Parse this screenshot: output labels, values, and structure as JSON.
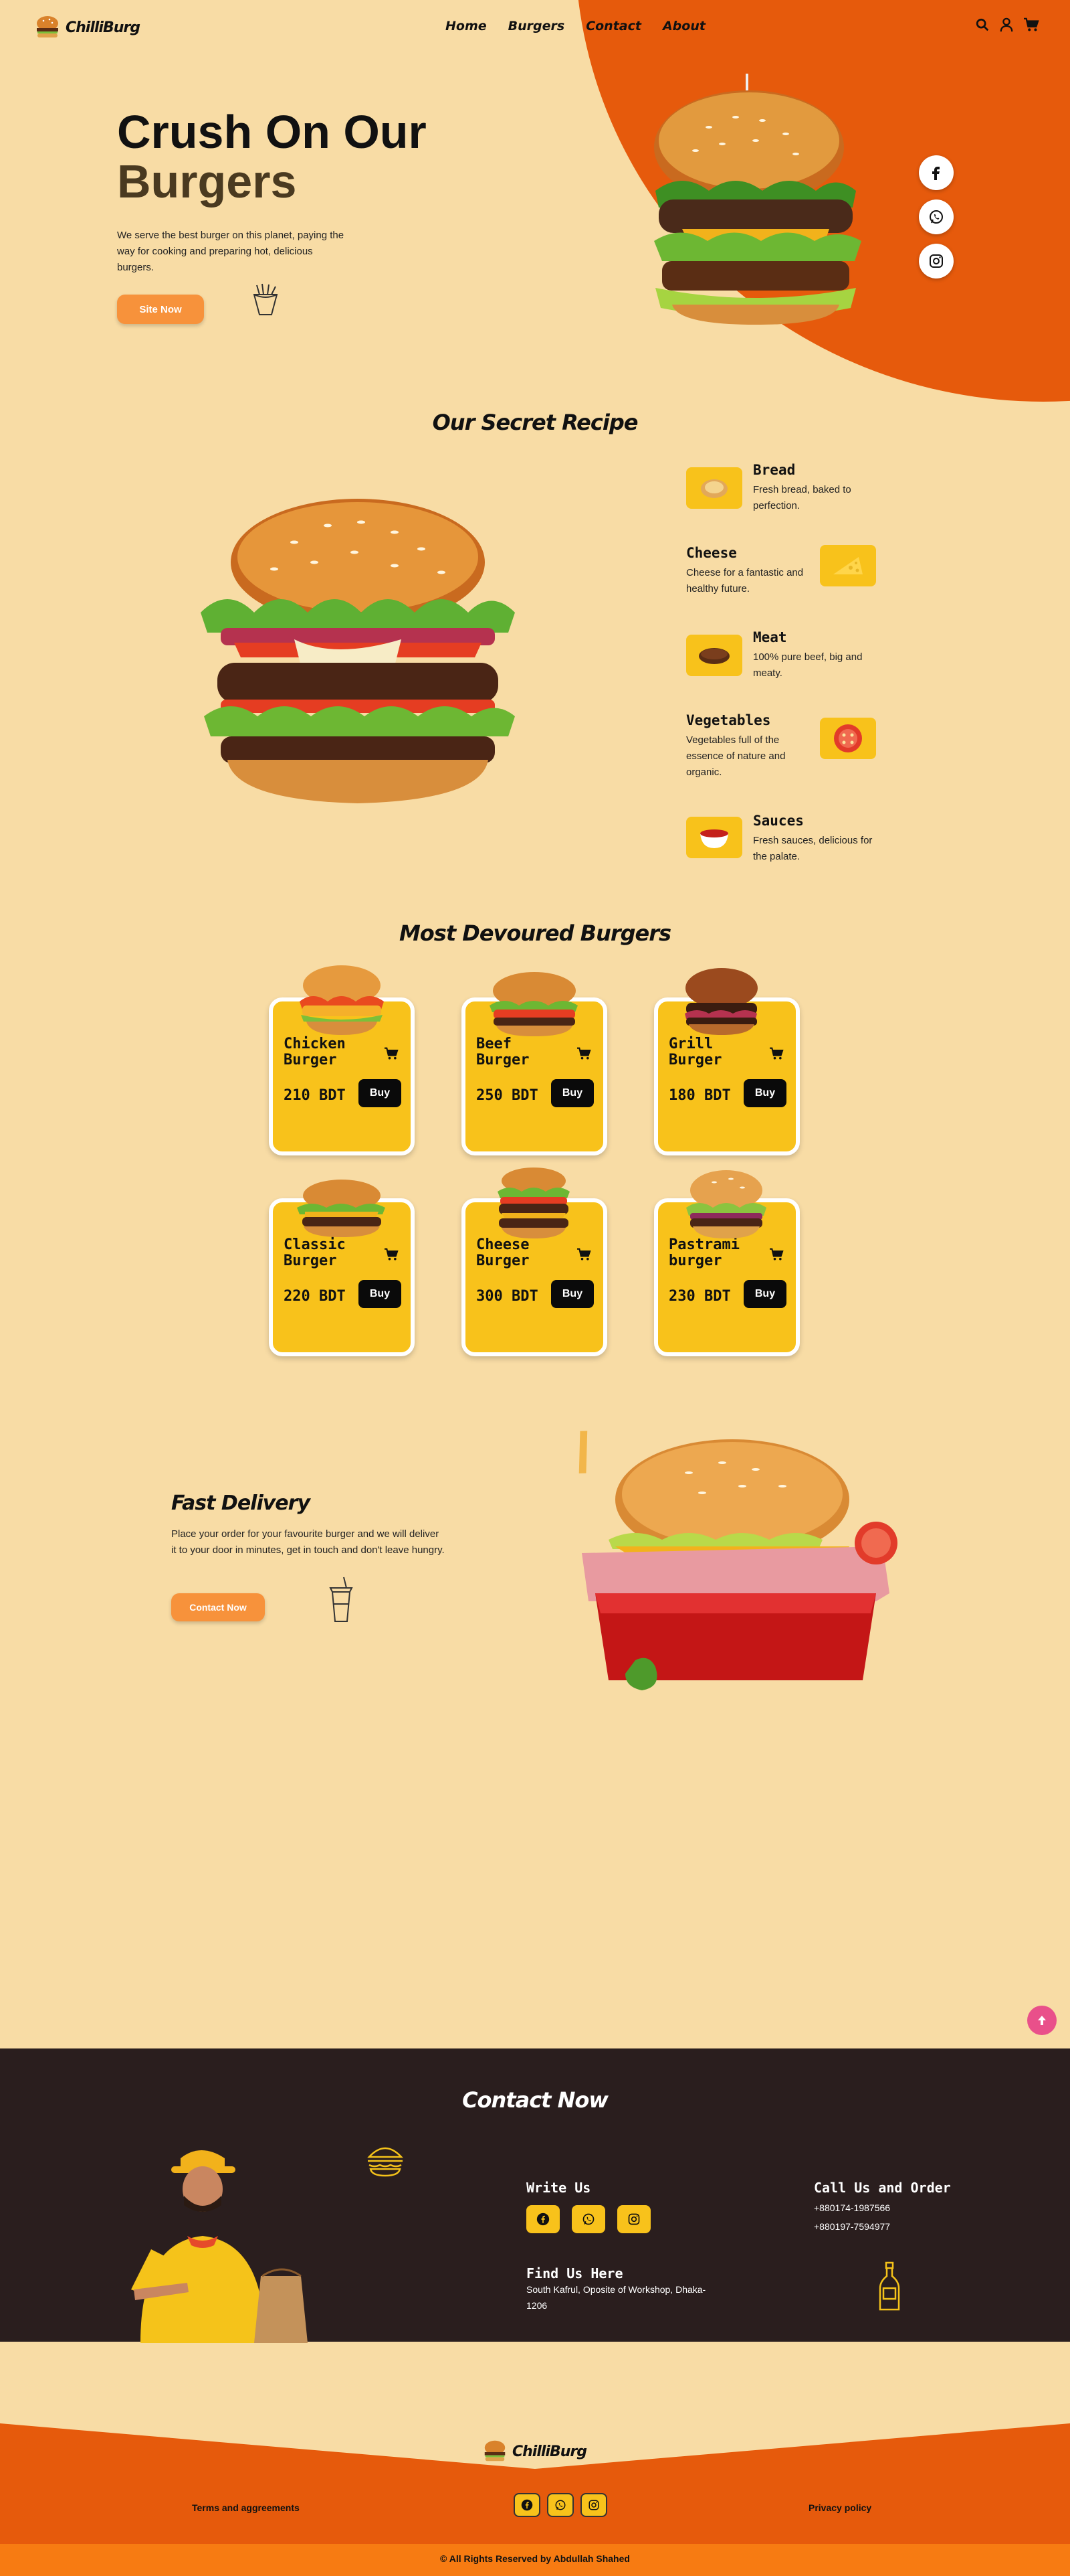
{
  "header": {
    "brand": "ChilliBurg",
    "nav": [
      "Home",
      "Burgers",
      "Contact",
      "About"
    ],
    "icons": [
      "search-icon",
      "user-icon",
      "cart-icon"
    ]
  },
  "hero": {
    "title_line1": "Crush On Our",
    "title_line2": "Burgers",
    "description": "We serve the best burger on this planet, paying the way for cooking and preparing hot, delicious burgers.",
    "button": "Site Now",
    "social": [
      "facebook-icon",
      "whatsapp-icon",
      "instagram-icon"
    ]
  },
  "recipe": {
    "title": "Our Secret Recipe",
    "items": [
      {
        "name": "Bread",
        "desc": "Fresh bread, baked to perfection."
      },
      {
        "name": "Cheese",
        "desc": "Cheese for a fantastic and healthy future."
      },
      {
        "name": "Meat",
        "desc": "100% pure beef, big and meaty."
      },
      {
        "name": "Vegetables",
        "desc": "Vegetables full of the essence of nature and organic."
      },
      {
        "name": "Sauces",
        "desc": "Fresh sauces, delicious for the palate."
      }
    ]
  },
  "popular": {
    "title": "Most Devoured Burgers",
    "buy_label": "Buy",
    "cards": [
      {
        "name": "Chicken Burger",
        "price": "210 BDT"
      },
      {
        "name": "Beef Burger",
        "price": "250 BDT"
      },
      {
        "name": "Grill Burger",
        "price": "180 BDT"
      },
      {
        "name": "Classic Burger",
        "price": "220 BDT"
      },
      {
        "name": "Cheese Burger",
        "price": "300 BDT"
      },
      {
        "name": "Pastrami burger",
        "price": "230 BDT"
      }
    ]
  },
  "delivery": {
    "title": "Fast Delivery",
    "description": "Place your order for your favourite burger and we will deliver it to your door in minutes, get in touch and don't leave hungry.",
    "button": "Contact Now"
  },
  "contact": {
    "title": "Contact Now",
    "write_us": "Write Us",
    "find_us": "Find Us Here",
    "address": "South Kafrul, Oposite of Workshop, Dhaka-1206",
    "call_title": "Call Us and Order",
    "phone1": "+880174-1987566",
    "phone2": "+880197-7594977"
  },
  "footer": {
    "brand": "ChilliBurg",
    "terms": "Terms and aggreements",
    "privacy": "Privacy policy",
    "copyright": "© All Rights Reserved by Abdullah Shahed"
  },
  "colors": {
    "background": "#f8dca5",
    "accent_orange": "#e65a0c",
    "yellow": "#f8c21b",
    "dark": "#2a1e1e",
    "button_orange": "#f7923b",
    "scroll_pink": "#e9508a"
  }
}
